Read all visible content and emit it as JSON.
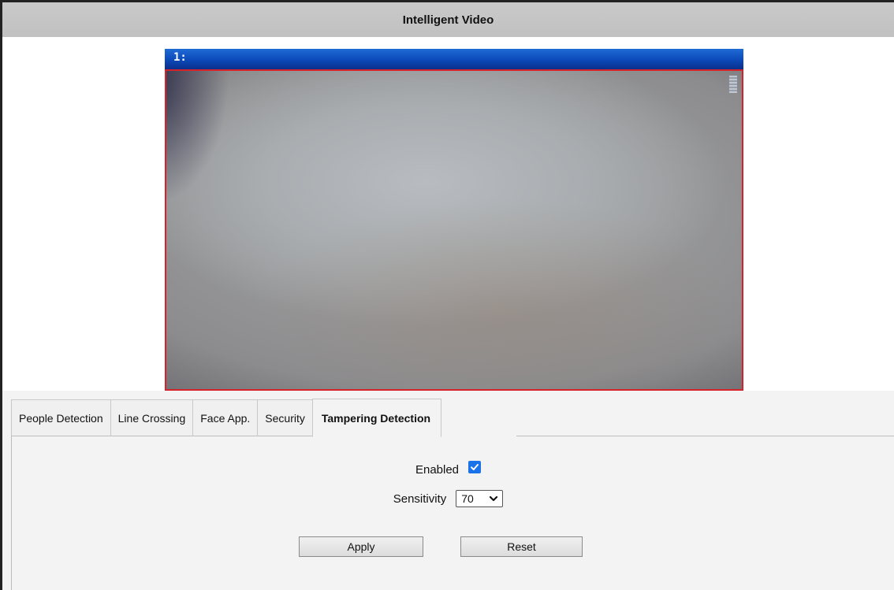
{
  "header": {
    "title": "Intelligent Video"
  },
  "video": {
    "channel_label": "1:"
  },
  "tabs": [
    {
      "label": "People Detection",
      "active": false
    },
    {
      "label": "Line Crossing",
      "active": false
    },
    {
      "label": "Face App.",
      "active": false
    },
    {
      "label": "Security",
      "active": false
    },
    {
      "label": "Tampering Detection",
      "active": true
    }
  ],
  "form": {
    "enabled_label": "Enabled",
    "enabled_checked": true,
    "sensitivity_label": "Sensitivity",
    "sensitivity_value": "70"
  },
  "buttons": {
    "apply_label": "Apply",
    "reset_label": "Reset"
  },
  "colors": {
    "video_border": "#d8222a",
    "video_header": "#0c49b8",
    "checkbox": "#1a73e8",
    "title_bar": "#c6c6c6"
  },
  "icons": {
    "checkbox": "checkmark-icon",
    "select": "chevron-down-icon"
  }
}
